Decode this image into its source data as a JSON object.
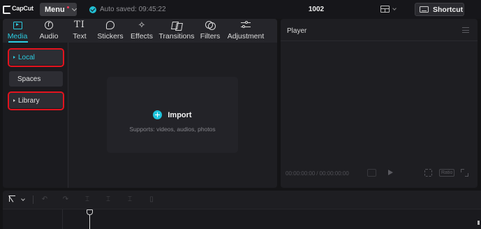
{
  "titlebar": {
    "app_name": "CapCut",
    "menu_label": "Menu",
    "autosave_text": "Auto saved: 09:45:22",
    "project_title": "1002",
    "shortcut_label": "Shortcut"
  },
  "tabs": [
    {
      "label": "Media",
      "icon": "media-icon",
      "active": true
    },
    {
      "label": "Audio",
      "icon": "audio-icon"
    },
    {
      "label": "Text",
      "icon": "text-icon"
    },
    {
      "label": "Stickers",
      "icon": "sticker-icon"
    },
    {
      "label": "Effects",
      "icon": "effects-icon"
    },
    {
      "label": "Transitions",
      "icon": "transitions-icon"
    },
    {
      "label": "Filters",
      "icon": "filters-icon"
    },
    {
      "label": "Adjustment",
      "icon": "adjustment-icon"
    }
  ],
  "sidebar": {
    "items": [
      {
        "label": "Local",
        "active": true,
        "highlighted": true
      },
      {
        "label": "Spaces"
      },
      {
        "label": "Library",
        "highlighted": true
      }
    ]
  },
  "import": {
    "label": "Import",
    "subtext": "Supports: videos, audios, photos"
  },
  "player": {
    "title": "Player",
    "current_time": "00:00:00:00",
    "total_time": "00:00:00:00",
    "ratio_label": "Ratio"
  },
  "colors": {
    "accent": "#2ccbe0",
    "highlight_annotation": "#e3131e",
    "background": "#141416",
    "panel": "#1e1e22"
  }
}
